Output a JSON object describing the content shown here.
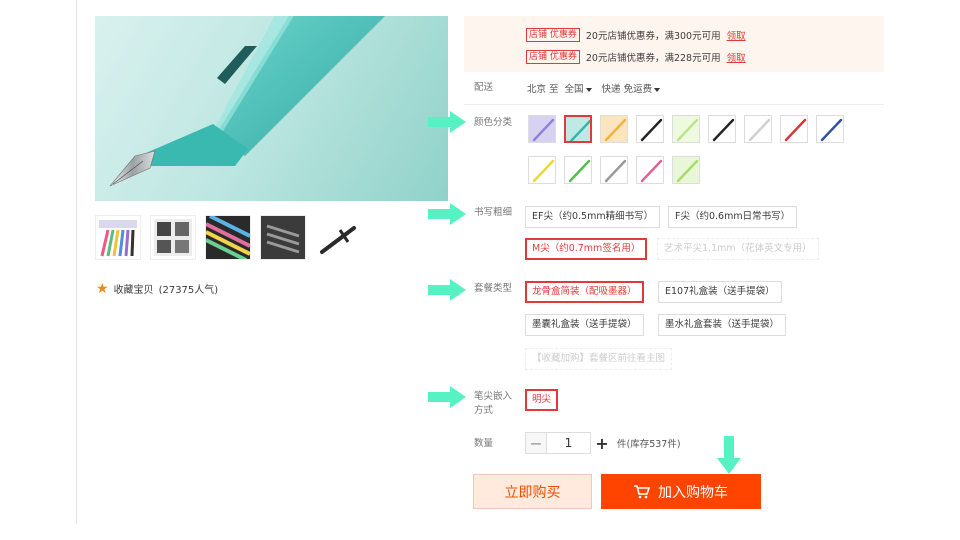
{
  "colors": {
    "accent": "#e4393c",
    "buy_bg": "#ffeadd",
    "cart_bg": "#ff4400",
    "arrow": "#57f2c4"
  },
  "favorite": {
    "label": "收藏宝贝",
    "count": "(27375人气)",
    "icon": "star-icon"
  },
  "promo": {
    "coupons": [
      {
        "tag": "店铺 优惠券",
        "text": "20元店铺优惠券，满300元可用",
        "link": "领取"
      },
      {
        "tag": "店铺 优惠券",
        "text": "20元店铺优惠券，满228元可用",
        "link": "领取"
      }
    ]
  },
  "shipping": {
    "label": "配送",
    "from": "北京 至",
    "to": "全国",
    "method": "快递 免运费"
  },
  "color_section": {
    "label": "颜色分类"
  },
  "nib_section": {
    "label": "书写粗细",
    "options": [
      {
        "label": "EF尖（约0.5mm精细书写）"
      },
      {
        "label": "F尖（约0.6mm日常书写）"
      },
      {
        "label": "M尖（约0.7mm签名用）"
      },
      {
        "label": "艺术平尖1.1mm（花体英文专用）"
      }
    ]
  },
  "package_section": {
    "label": "套餐类型",
    "options": [
      {
        "label": "龙骨盒简装（配吸墨器）"
      },
      {
        "label": "E107礼盒装（送手提袋）"
      },
      {
        "label": "墨囊礼盒装（送手提袋）"
      },
      {
        "label": "墨水礼盒套装（送手提袋）"
      },
      {
        "label": "【收藏加购】套餐区前往看主图"
      }
    ]
  },
  "nib_embed_section": {
    "label": "笔尖嵌入方式",
    "option": "明尖"
  },
  "quantity": {
    "label": "数量",
    "minus": "−",
    "value": "1",
    "plus": "+",
    "stock": "件(库存537件)"
  },
  "buttons": {
    "buy_now": "立即购买",
    "add_to_cart": "加入购物车"
  }
}
